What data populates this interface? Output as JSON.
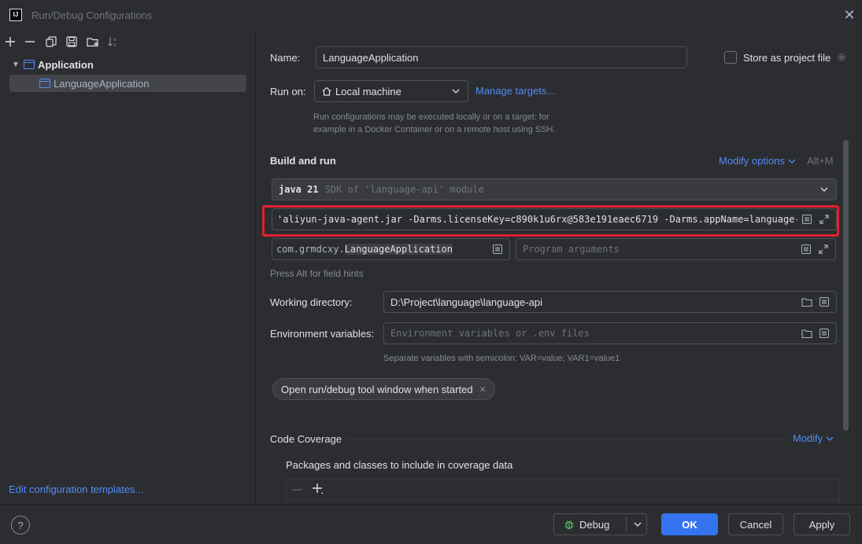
{
  "window": {
    "title": "Run/Debug Configurations",
    "logo_text": "IJ"
  },
  "toolbar": {
    "icons": [
      "add-icon",
      "remove-icon",
      "copy-icon",
      "save-icon",
      "add-folder-icon",
      "sort-icon"
    ]
  },
  "tree": {
    "group_label": "Application",
    "item_label": "LanguageApplication"
  },
  "left_footer": {
    "edit_templates": "Edit configuration templates..."
  },
  "form": {
    "name_label": "Name:",
    "name_value": "LanguageApplication",
    "store_project_label": "Store as project file",
    "run_on_label": "Run on:",
    "run_on_value": "Local machine",
    "manage_targets": "Manage targets...",
    "run_on_hint": "Run configurations may be executed locally or on a target: for\nexample in a Docker Container or on a remote host using SSH.",
    "build_run_title": "Build and run",
    "modify_options": "Modify options",
    "modify_shortcut": "Alt+M",
    "jdk_version": "java 21",
    "jdk_desc": "SDK of 'language-api' module",
    "vm_options": "'aliyun-java-agent.jar -Darms.licenseKey=c890k1u6rx@583e191eaec6719 -Darms.appName=language-api",
    "main_class_prefix": "com.grmdcxy.",
    "main_class_name": "LanguageApplication",
    "program_args_placeholder": "Program arguments",
    "field_hint": "Press Alt for field hints",
    "working_dir_label": "Working directory:",
    "working_dir_value": "D:\\Project\\language\\language-api",
    "env_label": "Environment variables:",
    "env_placeholder": "Environment variables or .env files",
    "env_hint": "Separate variables with semicolon: VAR=value; VAR1=value1",
    "open_tool_window_chip": "Open run/debug tool window when started",
    "code_coverage_title": "Code Coverage",
    "modify_link": "Modify",
    "packages_label": "Packages and classes to include in coverage data"
  },
  "footer": {
    "help": "?",
    "debug": "Debug",
    "ok": "OK",
    "cancel": "Cancel",
    "apply": "Apply"
  },
  "colors": {
    "background": "#2b2d30",
    "accent": "#3574f0",
    "link": "#548af7",
    "highlight_border": "#e5202e"
  }
}
